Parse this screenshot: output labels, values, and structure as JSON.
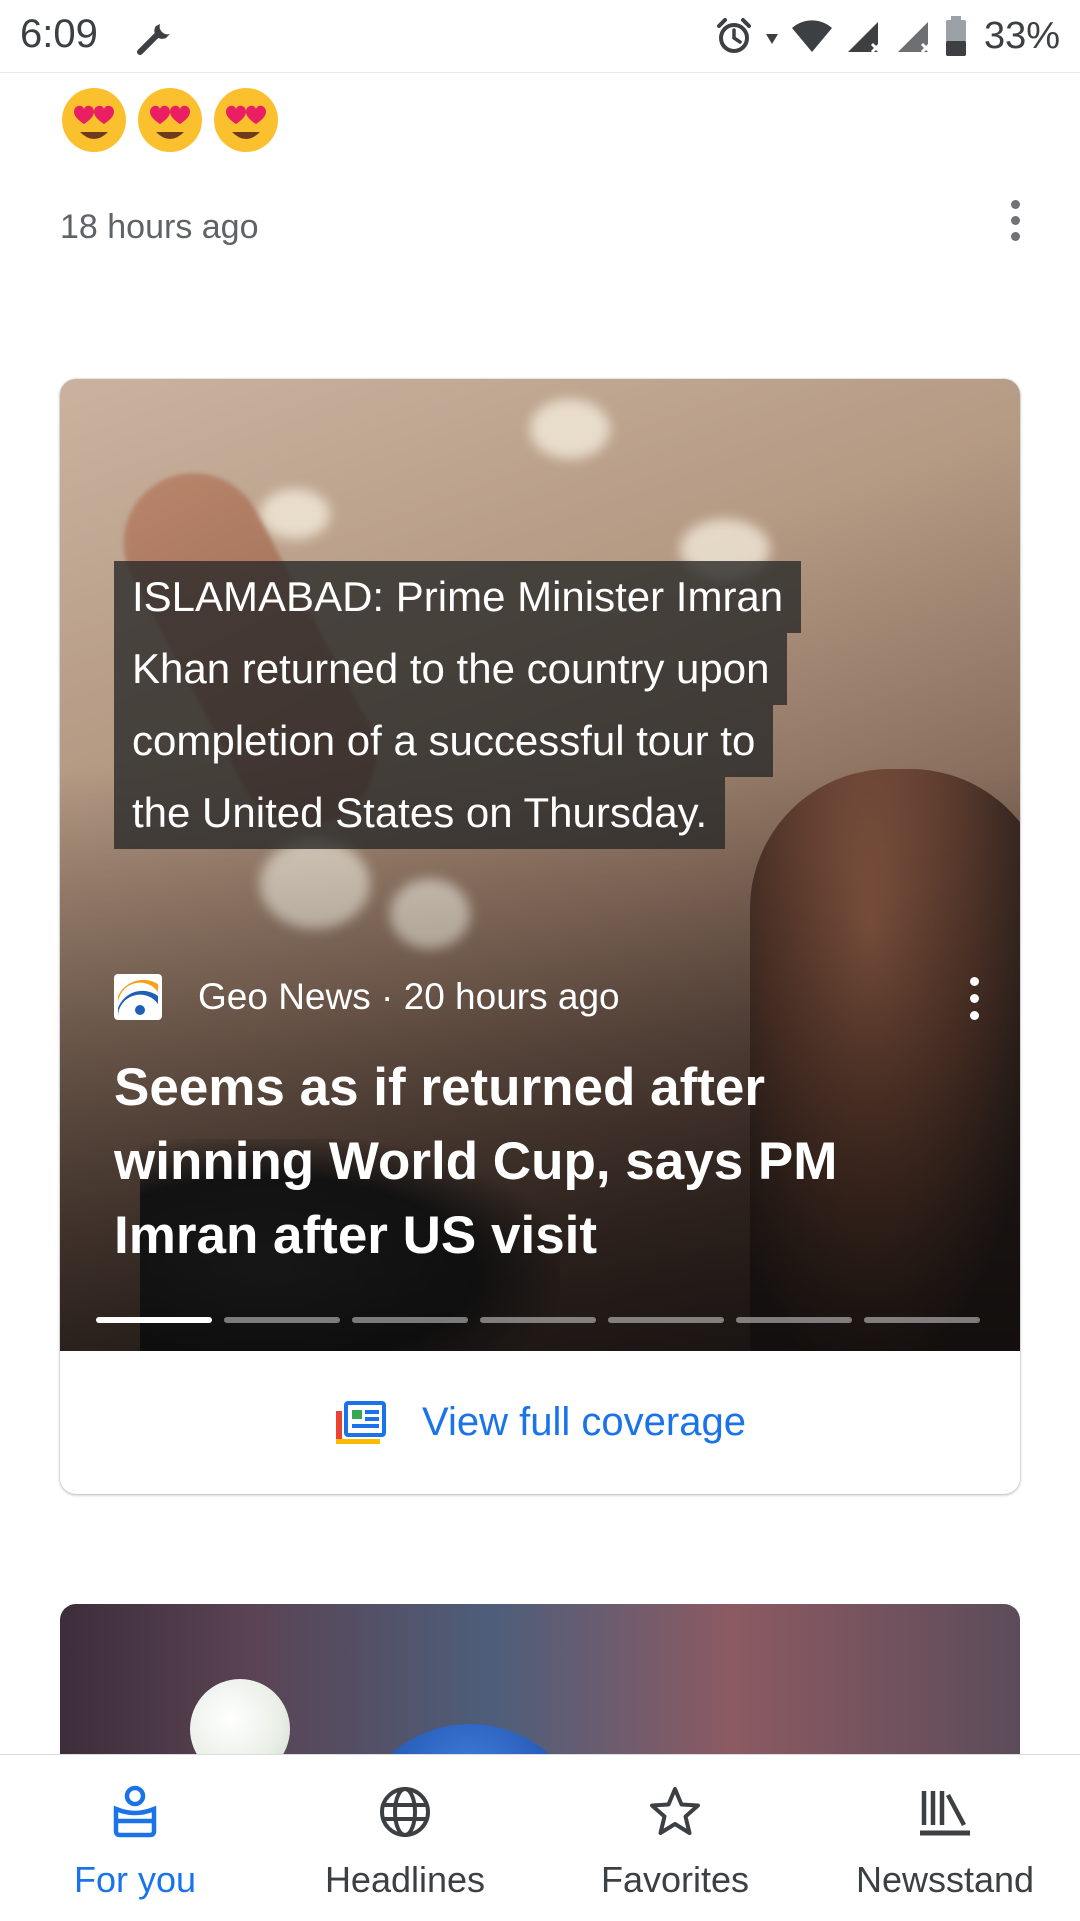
{
  "status_bar": {
    "time": "6:09",
    "battery": "33%",
    "icons": [
      "wrench-icon",
      "alarm-icon",
      "wifi-icon",
      "signal-icon",
      "signal-icon",
      "battery-icon"
    ]
  },
  "previous_item": {
    "emojis": [
      "heart-eyes-emoji",
      "heart-eyes-emoji",
      "heart-eyes-emoji"
    ],
    "time": "18 hours ago"
  },
  "story": {
    "quote_lines": [
      "ISLAMABAD: Prime Minister Imran",
      "Khan returned to the country upon",
      "completion of a successful tour to",
      "the United States on Thursday."
    ],
    "source": "Geo News · 20 hours ago",
    "headline": "Seems as if returned after winning World Cup, says PM Imran after US visit",
    "pages_total": 7,
    "active_page": 1,
    "coverage_label": "View full coverage"
  },
  "bottom_nav": {
    "items": [
      {
        "label": "For you",
        "icon": "for-you-icon"
      },
      {
        "label": "Headlines",
        "icon": "globe-icon"
      },
      {
        "label": "Favorites",
        "icon": "star-icon"
      },
      {
        "label": "Newsstand",
        "icon": "newsstand-icon"
      }
    ],
    "active_index": 0
  },
  "colors": {
    "accent": "#1a73e8",
    "text_secondary": "#5f6368"
  }
}
